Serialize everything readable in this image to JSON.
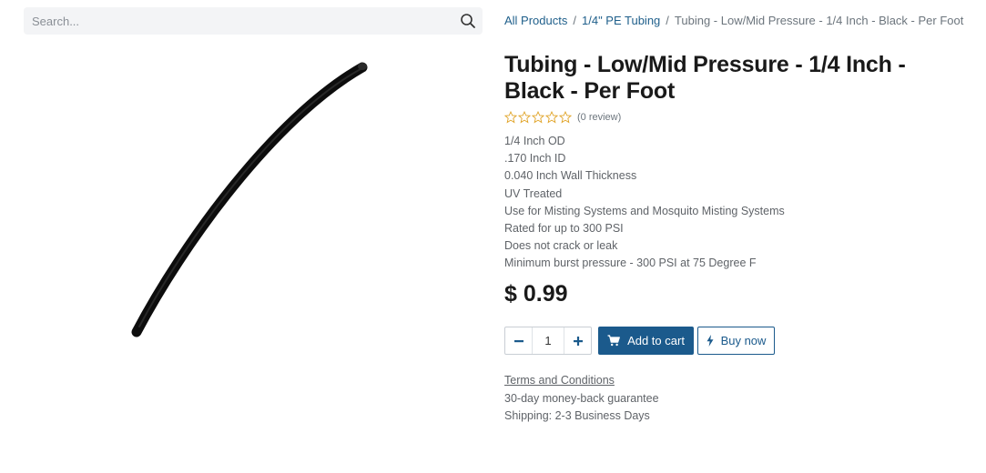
{
  "search": {
    "placeholder": "Search..."
  },
  "breadcrumb": {
    "items": [
      "All Products",
      "1/4\" PE Tubing"
    ],
    "separator": "/",
    "current": "Tubing - Low/Mid Pressure - 1/4 Inch - Black - Per Foot"
  },
  "product": {
    "title": "Tubing - Low/Mid Pressure - 1/4 Inch - Black - Per Foot",
    "rating": {
      "stars": 0,
      "max": 5,
      "review_text": "(0 review)"
    },
    "description": [
      "1/4 Inch OD",
      ".170 Inch ID",
      "0.040 Inch Wall Thickness",
      "UV Treated",
      "Use for Misting Systems and Mosquito Misting Systems",
      "Rated for up to 300 PSI",
      "Does not crack or leak",
      "Minimum burst pressure - 300 PSI at 75 Degree F"
    ],
    "price": "$ 0.99"
  },
  "cart": {
    "quantity": "1",
    "add_to_cart_label": "Add to cart",
    "buy_now_label": "Buy now"
  },
  "info": {
    "terms_label": "Terms and Conditions",
    "guarantee": "30-day money-back guarantee",
    "shipping": "Shipping: 2-3 Business Days"
  },
  "icons": {
    "search": "search-icon",
    "minus": "minus-icon",
    "plus": "plus-icon",
    "cart": "cart-icon",
    "bolt": "bolt-icon",
    "star": "star-outline-icon"
  },
  "colors": {
    "primary": "#1b5a8c",
    "link": "#1f5f8b",
    "star": "#e0a326",
    "text_muted": "#5f6368"
  }
}
